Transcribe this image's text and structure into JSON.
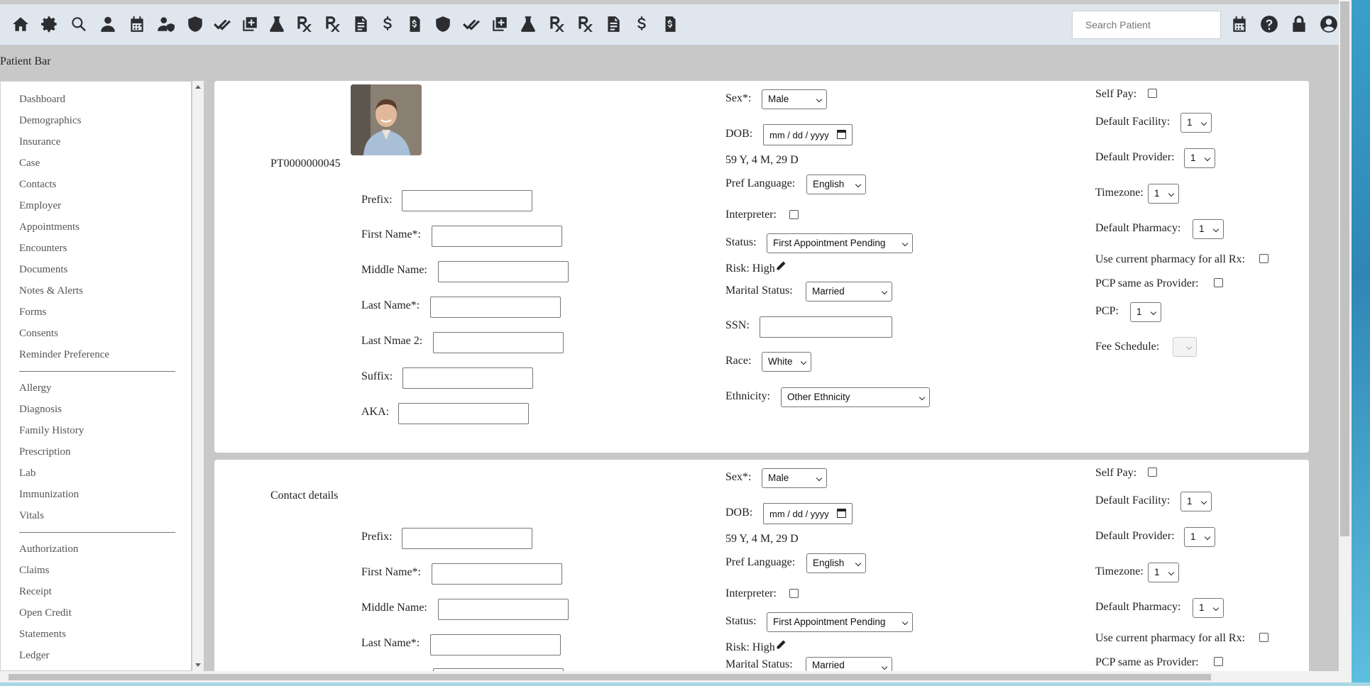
{
  "toolbar": {
    "icons": [
      "home-icon",
      "gear-icon",
      "search-icon",
      "user-icon",
      "calendar-icon",
      "user-shield-icon",
      "shield-icon",
      "check-double-icon",
      "add-box-icon",
      "flask-icon",
      "rx-icon",
      "rx-icon",
      "document-icon",
      "dollar-icon",
      "invoice-icon",
      "shield-icon",
      "check-double-icon",
      "add-box-icon",
      "flask-icon",
      "rx-icon",
      "rx-icon",
      "document-icon",
      "dollar-icon",
      "invoice-icon"
    ],
    "search_placeholder": "Search Patient",
    "right_icons": [
      "calendar-icon",
      "help-icon",
      "lock-icon",
      "account-icon"
    ]
  },
  "patient_bar_label": "Patient Bar",
  "sidebar": {
    "group1": [
      "Dashboard",
      "Demographics",
      "Insurance",
      "Case",
      "Contacts",
      "Employer",
      "Appointments",
      "Encounters",
      "Documents",
      "Notes & Alerts",
      "Forms",
      "Consents",
      "Reminder Preference"
    ],
    "group2": [
      "Allergy",
      "Diagnosis",
      "Family History",
      "Prescription",
      "Lab",
      "Immunization",
      "Vitals"
    ],
    "group3": [
      "Authorization",
      "Claims",
      "Receipt",
      "Open Credit",
      "Statements",
      "Ledger"
    ]
  },
  "card1": {
    "patient_id": "PT0000000045",
    "prefix": "Prefix:",
    "first_name": "First Name*:",
    "middle_name": "Middle Name:",
    "last_name": "Last Name*:",
    "last_name2": "Last Nmae 2:",
    "suffix": "Suffix:",
    "aka": "AKA:",
    "sex_label": "Sex*:",
    "sex_value": "Male",
    "dob_label": "DOB:",
    "dob_placeholder": "mm / dd / yyyy",
    "age": "59 Y, 4 M, 29 D",
    "pref_lang_label": "Pref Language:",
    "pref_lang_value": "English",
    "interpreter_label": "Interpreter:",
    "status_label": "Status:",
    "status_value": "First Appointment Pending",
    "risk": "Risk: High",
    "marital_label": "Marital Status:",
    "marital_value": "Married",
    "ssn_label": "SSN:",
    "race_label": "Race:",
    "race_value": "White",
    "ethnicity_label": "Ethnicity:",
    "ethnicity_value": "Other Ethnicity",
    "self_pay": "Self Pay:",
    "default_facility": "Default Facility:",
    "default_facility_value": "1",
    "default_provider": "Default Provider:",
    "default_provider_value": "1",
    "timezone": "Timezone:",
    "timezone_value": "1",
    "default_pharmacy": "Default Pharmacy:",
    "default_pharmacy_value": "1",
    "use_current_pharmacy": "Use current pharmacy for all Rx:",
    "pcp_same": "PCP same as Provider:",
    "pcp": "PCP:",
    "pcp_value": "1",
    "fee_schedule": "Fee Schedule:"
  },
  "card2": {
    "title": "Contact details",
    "prefix": "Prefix:",
    "first_name": "First Name*:",
    "middle_name": "Middle Name:",
    "last_name": "Last Name*:",
    "sex_label": "Sex*:",
    "sex_value": "Male",
    "dob_label": "DOB:",
    "dob_placeholder": "mm / dd / yyyy",
    "age": "59 Y, 4 M, 29 D",
    "pref_lang_label": "Pref Language:",
    "pref_lang_value": "English",
    "interpreter_label": "Interpreter:",
    "status_label": "Status:",
    "status_value": "First Appointment Pending",
    "risk": "Risk: High",
    "marital_label": "Marital Status:",
    "marital_value": "Married",
    "self_pay": "Self Pay:",
    "default_facility": "Default Facility:",
    "default_facility_value": "1",
    "default_provider": "Default Provider:",
    "default_provider_value": "1",
    "timezone": "Timezone:",
    "timezone_value": "1",
    "default_pharmacy": "Default Pharmacy:",
    "default_pharmacy_value": "1",
    "use_current_pharmacy": "Use current pharmacy for all Rx:",
    "pcp_same": "PCP same as Provider:"
  }
}
